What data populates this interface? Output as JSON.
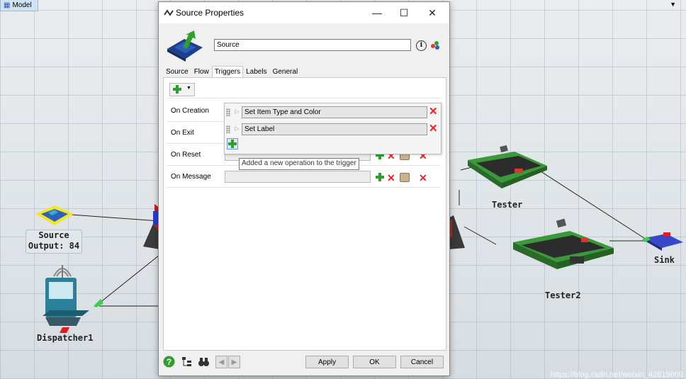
{
  "tab_bar": {
    "model_tab_label": "Model"
  },
  "scene": {
    "source_label_line1": "Source",
    "source_label_line2": "Output: 84",
    "dispatcher_label": "Dispatcher1",
    "tester_label": "Tester",
    "tester2_label": "Tester2",
    "sink_label": "Sink",
    "watermark": "https://blog.csdn.net/weixin_42815609"
  },
  "dialog": {
    "title": "Source  Properties",
    "object_name": "Source",
    "tabs": [
      "Source",
      "Flow",
      "Triggers",
      "Labels",
      "General"
    ],
    "active_tab": "Triggers",
    "triggers": [
      "On Creation",
      "On Exit",
      "On Reset",
      "On Message"
    ],
    "popup_operations": [
      "Set Item Type and Color",
      "Set Label"
    ],
    "tooltip": "Added a new operation to the trigger",
    "buttons": {
      "apply": "Apply",
      "ok": "OK",
      "cancel": "Cancel"
    }
  },
  "colors": {
    "accent_green": "#2e9e2e",
    "delete_red": "#e22222",
    "machine_green": "#3a9a3a",
    "source_yellow": "#f2e52a",
    "sink_blue": "#3848c8"
  }
}
